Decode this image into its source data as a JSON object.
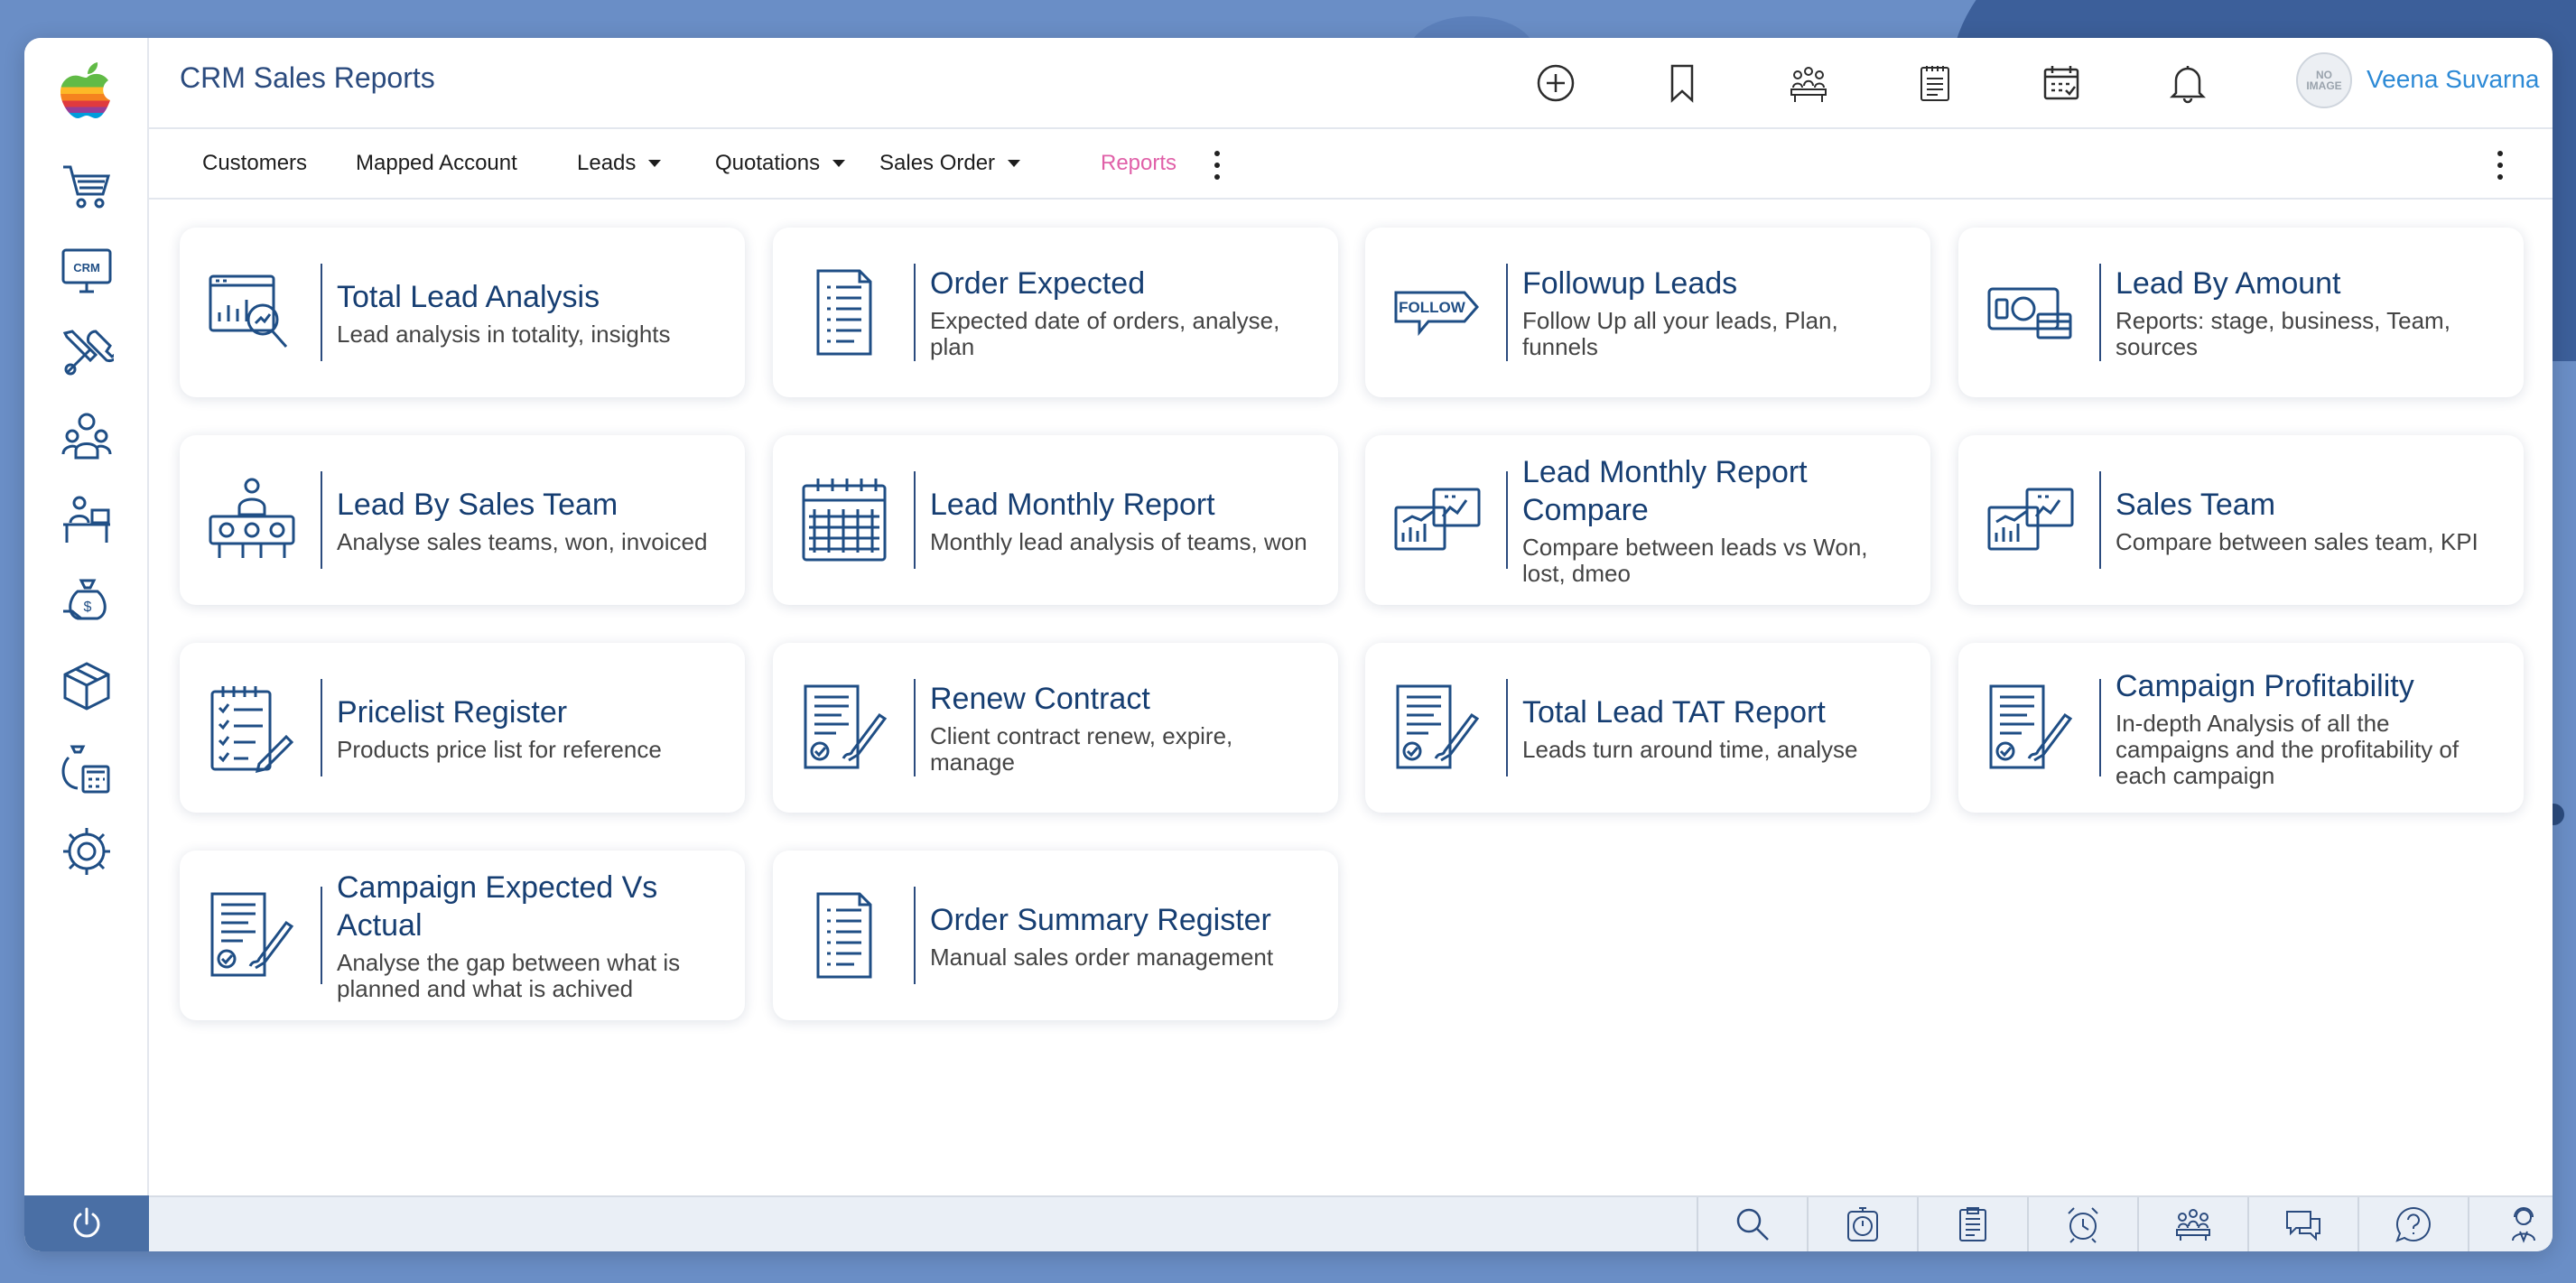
{
  "app": {
    "title": "CRM Sales Reports"
  },
  "user": {
    "name": "Veena Suvarna",
    "avatar_text": "NO IMAGE"
  },
  "colors": {
    "accent": "#2b4b7e",
    "active_nav": "#e060a8",
    "user_link": "#2d8ad6",
    "background": "#6a8ec6"
  },
  "sidebar": {
    "items": [
      {
        "icon": "cart-icon"
      },
      {
        "icon": "crm-monitor-icon",
        "text": "CRM"
      },
      {
        "icon": "tools-icon"
      },
      {
        "icon": "people-icon"
      },
      {
        "icon": "desk-icon"
      },
      {
        "icon": "money-bag-icon"
      },
      {
        "icon": "box-icon"
      },
      {
        "icon": "calculator-bag-icon"
      },
      {
        "icon": "gear-icon"
      }
    ]
  },
  "header_icons": [
    "plus-circle-icon",
    "bookmark-icon",
    "meeting-icon",
    "notepad-icon",
    "calendar-icon",
    "bell-icon"
  ],
  "nav": {
    "items": [
      {
        "label": "Customers",
        "dropdown": false
      },
      {
        "label": "Mapped Account",
        "dropdown": false
      },
      {
        "label": "Leads",
        "dropdown": true
      },
      {
        "label": "Quotations",
        "dropdown": true
      },
      {
        "label": "Sales Order",
        "dropdown": true
      },
      {
        "label": "Reports",
        "dropdown": false,
        "active": true
      }
    ]
  },
  "cards": [
    {
      "title": "Total Lead Analysis",
      "desc": "Lead analysis in totality, insights",
      "icon": "analysis-icon"
    },
    {
      "title": "Order Expected",
      "desc": "Expected date of orders, analyse, plan",
      "icon": "document-list-icon"
    },
    {
      "title": "Followup Leads",
      "desc": "Follow Up all your leads, Plan, funnels",
      "icon": "follow-icon"
    },
    {
      "title": "Lead By Amount",
      "desc": "Reports: stage, business, Team, sources",
      "icon": "cash-icon"
    },
    {
      "title": "Lead By Sales Team",
      "desc": "Analyse sales teams, won, invoiced",
      "icon": "team-icon"
    },
    {
      "title": "Lead Monthly Report",
      "desc": "Monthly lead analysis of teams, won",
      "icon": "calendar-grid-icon"
    },
    {
      "title": "Lead Monthly Report Compare",
      "desc": "Compare between leads vs Won, lost, dmeo",
      "icon": "charts-compare-icon"
    },
    {
      "title": "Sales Team",
      "desc": "Compare between sales team, KPI",
      "icon": "charts-compare-icon"
    },
    {
      "title": "Pricelist Register",
      "desc": "Products price list for reference",
      "icon": "checklist-icon"
    },
    {
      "title": "Renew Contract",
      "desc": "Client contract renew, expire, manage",
      "icon": "contract-icon"
    },
    {
      "title": "Total Lead TAT Report",
      "desc": "Leads turn around time, analyse",
      "icon": "contract-icon"
    },
    {
      "title": "Campaign Profitability",
      "desc": "In-depth Analysis of all the campaigns and the profitability of each campaign",
      "icon": "contract-icon"
    },
    {
      "title": "Campaign Expected Vs Actual",
      "desc": "Analyse the gap between what is planned and what is achived",
      "icon": "contract-icon"
    },
    {
      "title": "Order Summary Register",
      "desc": "Manual sales order management",
      "icon": "document-list-icon"
    }
  ],
  "footer_icons": [
    "search-icon",
    "stopwatch-icon",
    "clipboard-icon",
    "alarm-icon",
    "meeting-icon",
    "chat-icon",
    "help-icon",
    "support-agent-icon"
  ]
}
